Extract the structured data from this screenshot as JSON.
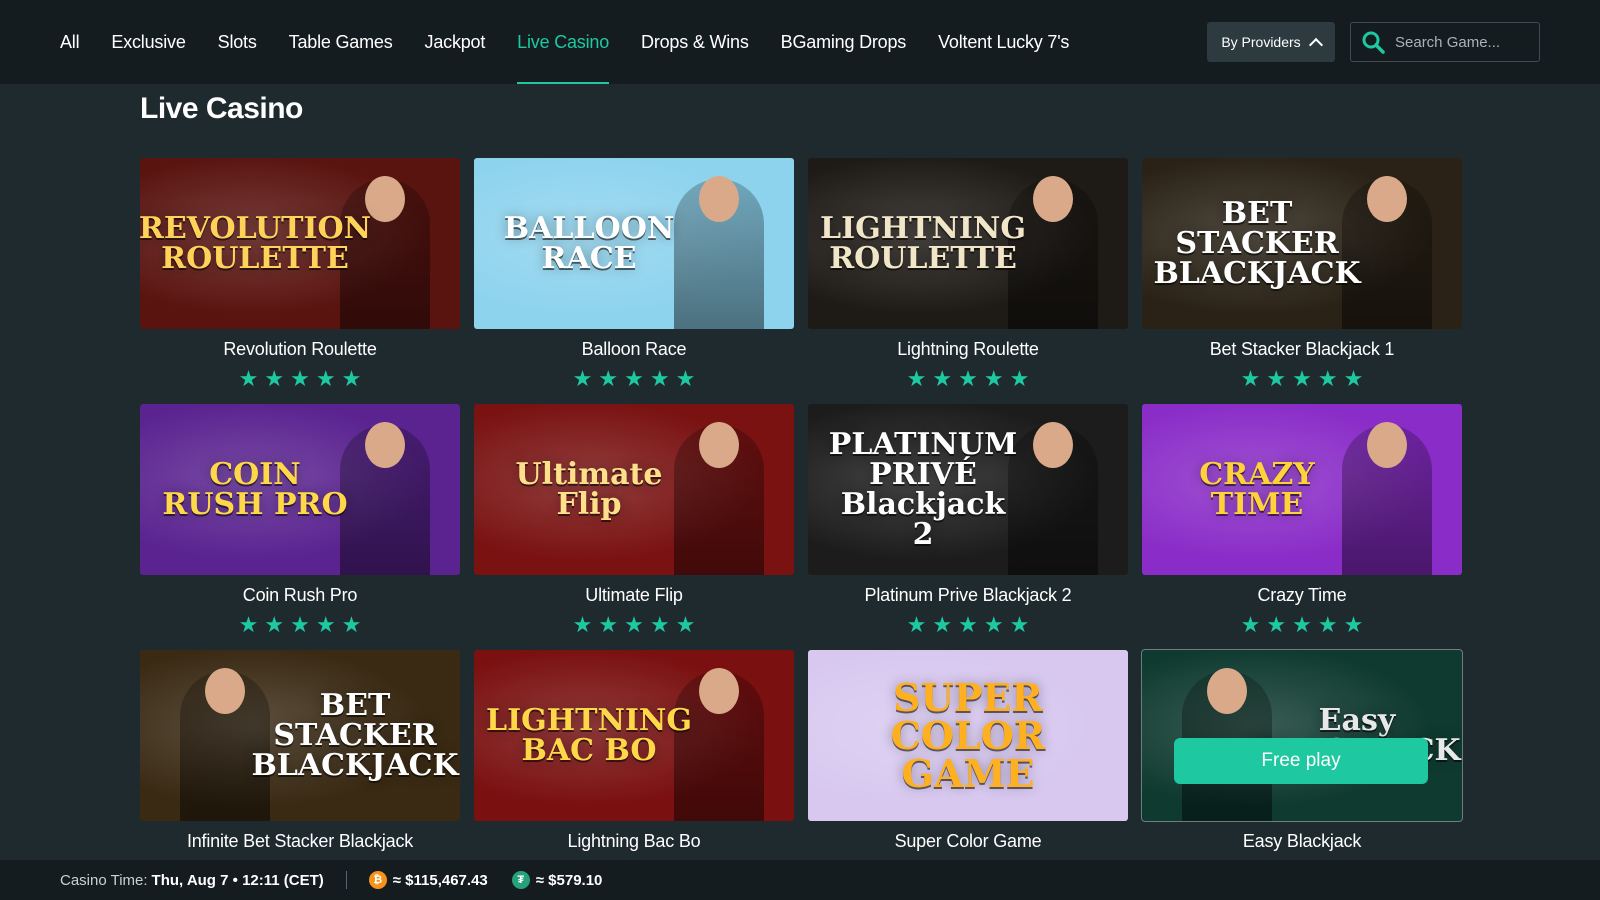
{
  "nav": {
    "tabs": [
      {
        "label": "All"
      },
      {
        "label": "Exclusive"
      },
      {
        "label": "Slots"
      },
      {
        "label": "Table Games"
      },
      {
        "label": "Jackpot"
      },
      {
        "label": "Live Casino"
      },
      {
        "label": "Drops & Wins"
      },
      {
        "label": "BGaming Drops"
      },
      {
        "label": "Voltent Lucky 7's"
      }
    ],
    "active_tab": "Live Casino",
    "providers_label": "By Providers",
    "search_placeholder": "Search Game..."
  },
  "page_title": "Live Casino",
  "games": [
    {
      "name": "Revolution Roulette",
      "logo": "REVOLUTION ROULETTE",
      "rating": 5,
      "bg": "#5a1410"
    },
    {
      "name": "Balloon Race",
      "logo": "BALLOON RACE",
      "rating": 5,
      "bg": "#8ed3ee"
    },
    {
      "name": "Lightning Roulette",
      "logo": "LIGHTNING ROULETTE",
      "rating": 5,
      "bg": "#1e1a16"
    },
    {
      "name": "Bet Stacker Blackjack 1",
      "logo": "BET STACKER BLACKJACK",
      "rating": 5,
      "bg": "#2a2216"
    },
    {
      "name": "Coin Rush Pro",
      "logo": "COIN RUSH PRO",
      "rating": 5,
      "bg": "#5a2390"
    },
    {
      "name": "Ultimate Flip",
      "logo": "Ultimate Flip",
      "rating": 5,
      "bg": "#7a1212"
    },
    {
      "name": "Platinum Prive Blackjack 2",
      "logo": "PLATINUM PRIVÉ Blackjack 2",
      "rating": 5,
      "bg": "#1c1c1c"
    },
    {
      "name": "Crazy Time",
      "logo": "CRAZY TIME",
      "rating": 5,
      "bg": "#8a2cc8"
    },
    {
      "name": "Infinite Bet Stacker Blackjack",
      "logo": "BET STACKER BLACKJACK",
      "rating": 0,
      "bg": "#3a2a14"
    },
    {
      "name": "Lightning Bac Bo",
      "logo": "LIGHTNING BAC BO",
      "rating": 0,
      "bg": "#7a1010"
    },
    {
      "name": "Super Color Game",
      "logo": "SUPER COLOR GAME",
      "rating": 0,
      "bg": "#d8c8f0"
    },
    {
      "name": "Easy Blackjack",
      "logo": "Easy BLACKJACK",
      "rating": 0,
      "bg": "#0f3a30"
    }
  ],
  "free_play_label": "Free play",
  "footer": {
    "casino_time_label": "Casino Time:",
    "casino_time_value": "Thu, Aug 7 • 12:11 (CET)",
    "btc_amount": "≈ $115,467.43",
    "usdt_amount": "≈ $579.10"
  },
  "colors": {
    "accent": "#1ec8a0",
    "page_bg": "#1f2a2e",
    "nav_bg": "#141c20"
  }
}
